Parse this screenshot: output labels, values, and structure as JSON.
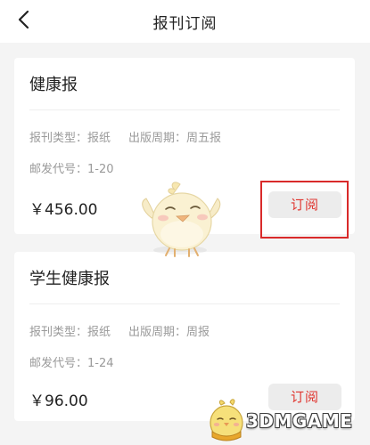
{
  "header": {
    "title": "报刊订阅",
    "back_icon": "chevron-left-icon"
  },
  "publications": [
    {
      "name": "健康报",
      "type_label": "报刊类型：",
      "type_value": "报纸",
      "cycle_label": "出版周期：",
      "cycle_value": "周五报",
      "code_label": "邮发代号：",
      "code_value": "1-20",
      "price": "￥456.00",
      "subscribe_label": "订阅"
    },
    {
      "name": "学生健康报",
      "type_label": "报刊类型：",
      "type_value": "报纸",
      "cycle_label": "出版周期：",
      "cycle_value": "周报",
      "code_label": "邮发代号：",
      "code_value": "1-24",
      "price": "￥96.00",
      "subscribe_label": "订阅"
    }
  ],
  "watermark": {
    "text": "3DMGAME"
  },
  "colors": {
    "accent": "#e0352f",
    "highlight_border": "#d92a2a",
    "muted_text": "#9a9a9a",
    "button_bg": "#ececec",
    "page_bg": "#f4f4f4"
  }
}
